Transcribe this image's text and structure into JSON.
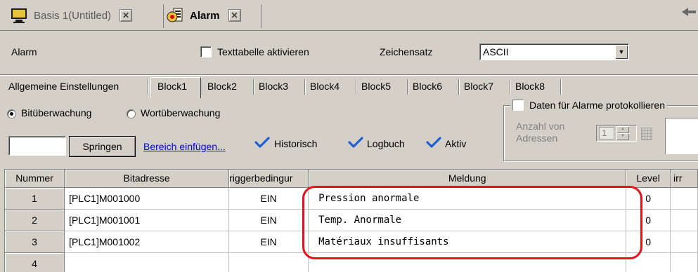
{
  "doc_tabs": [
    {
      "label": "Basis 1(Untitled)",
      "close": "✕",
      "active": false
    },
    {
      "label": "Alarm",
      "close": "✕",
      "active": true
    }
  ],
  "header": {
    "alarm_label": "Alarm",
    "texttable_label": "Texttabelle aktivieren",
    "texttable_checked": false,
    "charset_label": "Zeichensatz",
    "charset_value": "ASCII"
  },
  "block_tabs": [
    "Allgemeine Einstellungen",
    "Block1",
    "Block2",
    "Block3",
    "Block4",
    "Block5",
    "Block6",
    "Block7",
    "Block8"
  ],
  "active_block_tab": "Block1",
  "monitoring": {
    "bit_label": "Bitüberwachung",
    "word_label": "Wortüberwachung",
    "selected": "bit"
  },
  "jump": {
    "input_value": "",
    "button_label": "Springen",
    "insert_link": "Bereich einfügen..."
  },
  "options": {
    "historic": "Historisch",
    "logbook": "Logbuch",
    "active": "Aktiv"
  },
  "log_group": {
    "title": "Daten für Alarme protokollieren",
    "count_label_1": "Anzahl von",
    "count_label_2": "Adressen",
    "count_value": "1"
  },
  "table": {
    "headers": {
      "number": "Nummer",
      "address": "Bitadresse",
      "trigger": "riggerbedingur",
      "message": "Meldung",
      "level": "Level",
      "extra": "irr"
    },
    "rows": [
      {
        "number": "1",
        "address": "[PLC1]M001000",
        "trigger": "EIN",
        "message": "Pression anormale",
        "level": "0"
      },
      {
        "number": "2",
        "address": "[PLC1]M001001",
        "trigger": "EIN",
        "message": "Temp. Anormale",
        "level": "0"
      },
      {
        "number": "3",
        "address": "[PLC1]M001002",
        "trigger": "EIN",
        "message": "Matériaux insuffisants",
        "level": "0"
      },
      {
        "number": "4",
        "address": "",
        "trigger": "",
        "message": "",
        "level": ""
      }
    ]
  },
  "colors": {
    "window_bg": "#d4d0c8",
    "link": "#0000ee",
    "check": "#1f5fd6",
    "highlight": "#e8101a"
  }
}
